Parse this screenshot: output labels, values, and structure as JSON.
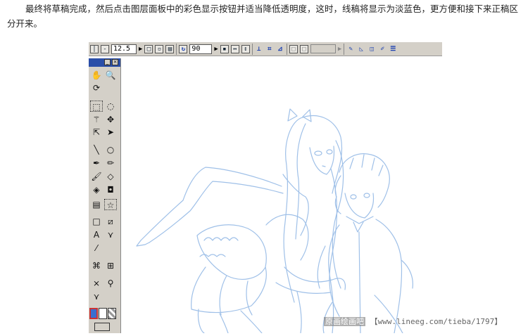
{
  "caption": {
    "text": "最终将草稿完成，然后点击图层面板中的彩色显示按钮并适当降低透明度，这时，线稿将显示为淡蓝色，更方便和接下来正稿区分开来。"
  },
  "toolbar": {
    "zoom_value": "12.5",
    "angle_value": "90"
  },
  "watermark": {
    "brand": "原画绘画吧",
    "url": "【www.lineeg.com/tieba/1797】"
  },
  "colors": {
    "panel_bg": "#d4d0c8",
    "title_blue": "#2a4ea8",
    "sketch_blue": "#9fc0e8",
    "fg_swatch": "#3a6fd0"
  },
  "icons": {
    "toolbar": [
      "prev-page-icon",
      "next-page-icon",
      "new-page-icon",
      "copy-icon",
      "paste-icon",
      "rotate-icon",
      "fit-icon",
      "fit-width-icon",
      "fit-height-icon",
      "ruler-icon",
      "grid-icon",
      "perspective-icon",
      "layer-icon",
      "layer2-icon",
      "pen-icon",
      "triangle-icon",
      "cube-icon",
      "brush-icon",
      "list-icon"
    ],
    "tools": [
      "hand-icon",
      "zoom-icon",
      "rotate-view-icon",
      "rect-select-icon",
      "lasso-icon",
      "magic-wand-icon",
      "move-icon",
      "transform-icon",
      "pointer-icon",
      "line-icon",
      "ellipse-icon",
      "pen-tool-icon",
      "pencil-icon",
      "brush-tool-icon",
      "eraser-icon",
      "fill-icon",
      "fill-select-icon",
      "gradient-icon",
      "star-icon",
      "frame-icon",
      "frame2-icon",
      "text-icon",
      "balloon-icon",
      "eyedropper-icon",
      "tone-icon",
      "tone2-icon",
      "effect-icon",
      "zoom2-icon"
    ]
  }
}
